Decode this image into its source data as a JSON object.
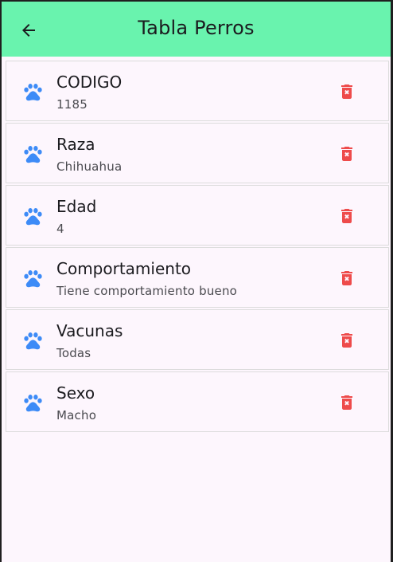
{
  "appbar": {
    "title": "Tabla Perros",
    "back_icon": "arrow-back-icon",
    "color": "#69f3ae"
  },
  "items": [
    {
      "title": "CODIGO",
      "subtitle": "1185"
    },
    {
      "title": "Raza",
      "subtitle": "Chihuahua"
    },
    {
      "title": "Edad",
      "subtitle": "4"
    },
    {
      "title": "Comportamiento",
      "subtitle": "Tiene comportamiento bueno"
    },
    {
      "title": "Vacunas",
      "subtitle": "Todas"
    },
    {
      "title": "Sexo",
      "subtitle": "Macho"
    }
  ],
  "icons": {
    "leading": "paw-icon",
    "trailing": "delete-forever-icon"
  },
  "colors": {
    "paw": "#3d8bf7",
    "delete": "#ee4b4b",
    "background": "#fdf6fd"
  }
}
